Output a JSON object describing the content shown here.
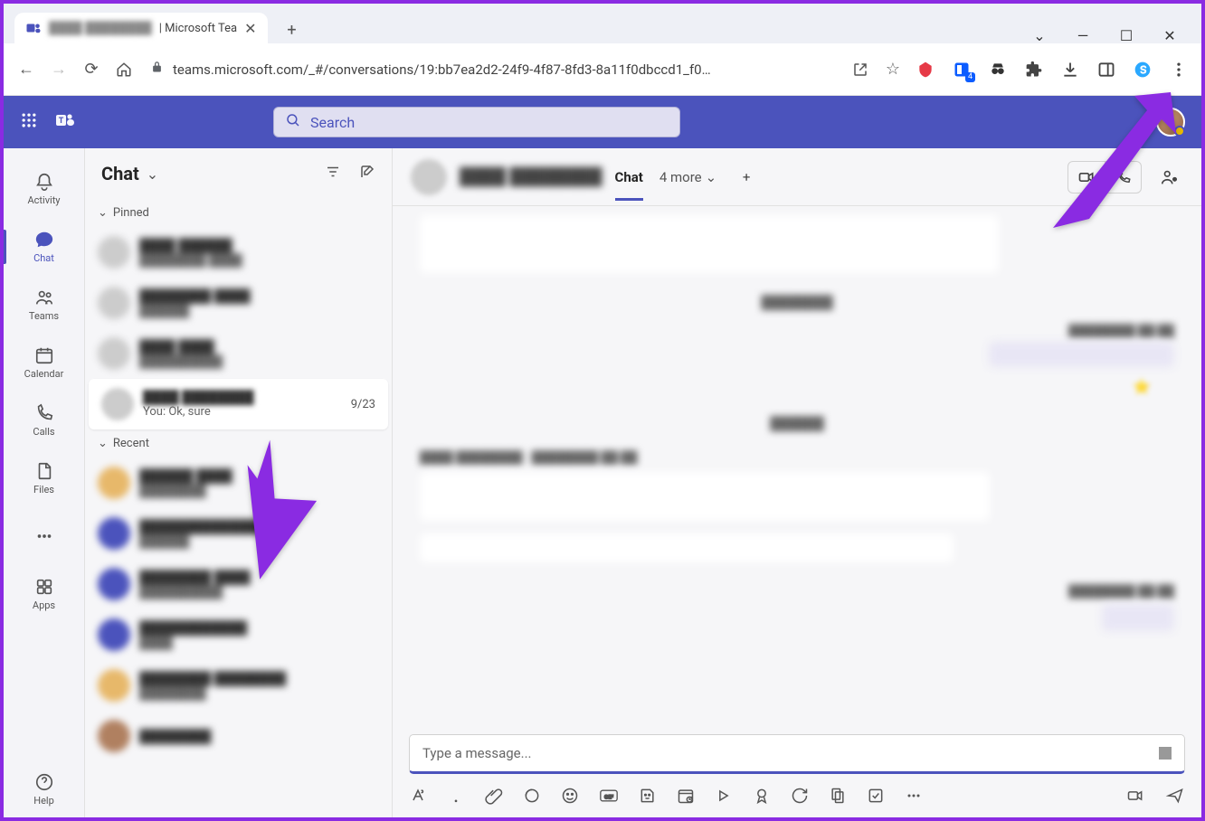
{
  "browser": {
    "tab_title_suffix": "| Microsoft Tea",
    "url": "teams.microsoft.com/_#/conversations/19:bb7ea2d2-24f9-4f87-8fd3-8a11f0dbccd1_f0…",
    "url_truncation": "…",
    "extension_badge": "4"
  },
  "teams": {
    "search_placeholder": "Search",
    "left_rail": {
      "activity": "Activity",
      "chat": "Chat",
      "teams": "Teams",
      "calendar": "Calendar",
      "calls": "Calls",
      "files": "Files",
      "apps": "Apps",
      "help": "Help"
    },
    "chat_panel": {
      "title": "Chat",
      "pinned_label": "Pinned",
      "recent_label": "Recent",
      "selected": {
        "preview": "You: Ok, sure",
        "timestamp": "9/23"
      }
    },
    "conversation": {
      "tab_chat": "Chat",
      "more_tabs": "4 more",
      "composer_placeholder": "Type a message..."
    }
  }
}
